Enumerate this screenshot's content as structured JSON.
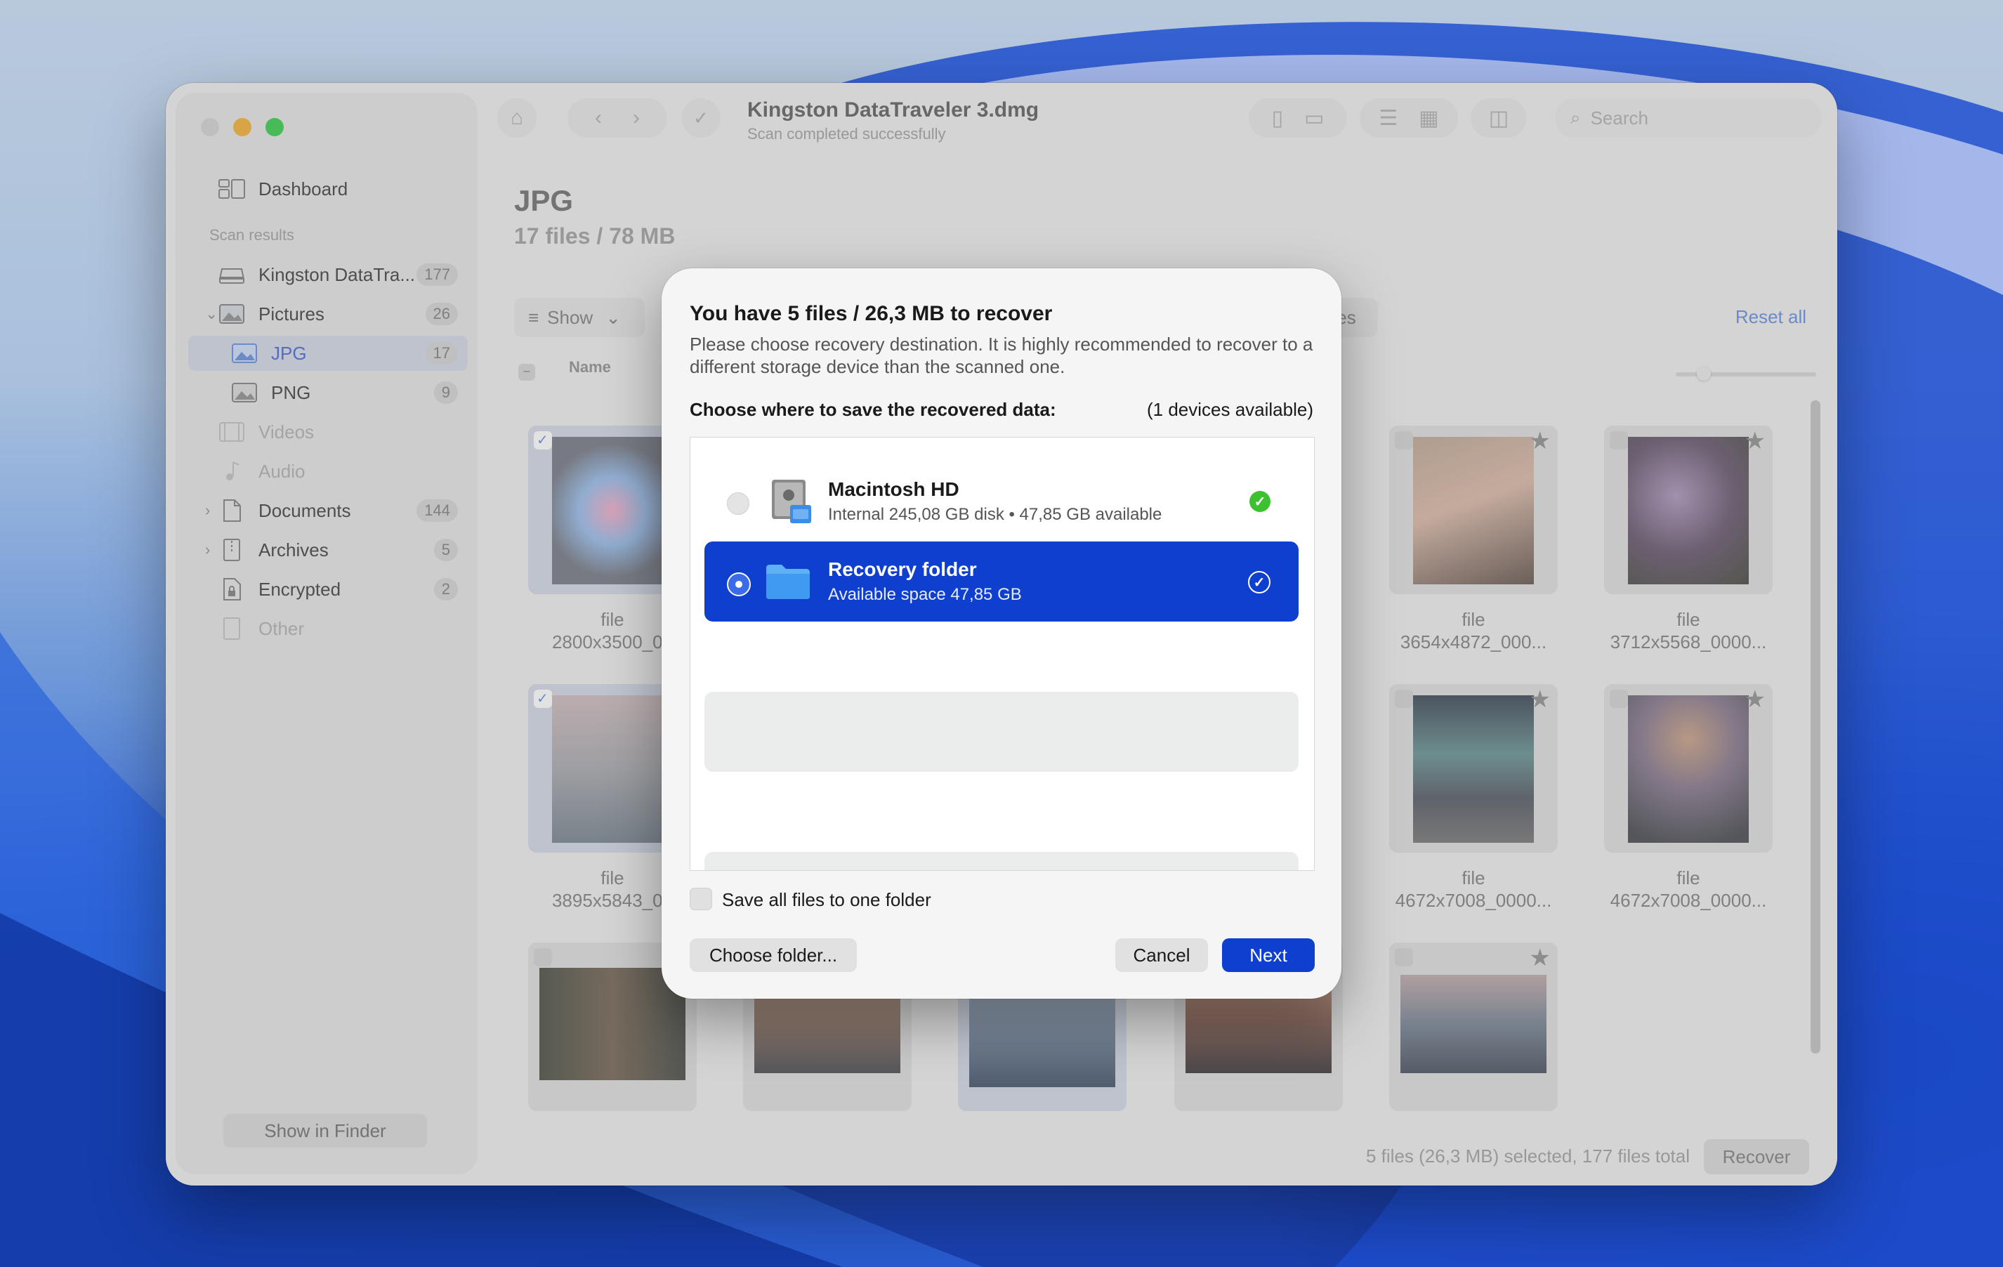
{
  "window": {
    "title": "Kingston DataTraveler 3.dmg",
    "subtitle": "Scan completed successfully",
    "search_placeholder": "Search"
  },
  "sidebar": {
    "dashboard_label": "Dashboard",
    "section_caption": "Scan results",
    "items": [
      {
        "label": "Kingston DataTra...",
        "count": "177",
        "icon": "drive-icon"
      },
      {
        "label": "Pictures",
        "count": "26",
        "icon": "pictures-icon"
      },
      {
        "label": "JPG",
        "count": "17",
        "icon": "image-icon"
      },
      {
        "label": "PNG",
        "count": "9",
        "icon": "image-icon"
      },
      {
        "label": "Videos",
        "count": "",
        "icon": "video-icon"
      },
      {
        "label": "Audio",
        "count": "",
        "icon": "music-icon"
      },
      {
        "label": "Documents",
        "count": "144",
        "icon": "document-icon"
      },
      {
        "label": "Archives",
        "count": "5",
        "icon": "archive-icon"
      },
      {
        "label": "Encrypted",
        "count": "2",
        "icon": "lock-document-icon"
      },
      {
        "label": "Other",
        "count": "",
        "icon": "file-icon"
      }
    ],
    "show_in_finder": "Show in Finder"
  },
  "main": {
    "heading": "JPG",
    "summary": "17 files / 78 MB",
    "show_button": "Show",
    "reset_all": "Reset all",
    "column_name": "Name",
    "partial_chip_text": "es",
    "files": [
      {
        "line1": "file",
        "line2": "2800x3500_00"
      },
      {
        "line1": "file",
        "line2": "3654x4872_000..."
      },
      {
        "line1": "file",
        "line2": "3712x5568_0000..."
      },
      {
        "line1": "file",
        "line2": "3895x5843_00"
      },
      {
        "line1": "file",
        "line2": "4672x7008_0000..."
      },
      {
        "line1": "file",
        "line2": "4672x7008_0000..."
      }
    ]
  },
  "status_bar": {
    "summary": "5 files (26,3 MB) selected, 177 files total",
    "recover_button": "Recover"
  },
  "dialog": {
    "title": "You have 5 files / 26,3 MB to recover",
    "description": "Please choose recovery destination. It is highly recommended to recover to a different storage device than the scanned one.",
    "choose_label": "Choose where to save the recovered data:",
    "devices_available": "(1 devices available)",
    "destinations": [
      {
        "name": "Macintosh HD",
        "meta": "Internal 245,08 GB disk • 47,85 GB available",
        "selected": false
      },
      {
        "name": "Recovery folder",
        "meta": "Available space 47,85 GB",
        "selected": true
      }
    ],
    "save_all_label": "Save all files to one folder",
    "choose_folder_button": "Choose folder...",
    "cancel_button": "Cancel",
    "next_button": "Next"
  },
  "colors": {
    "accent": "#0f3fce",
    "success": "#3ec130",
    "traffic_yellow": "#f2a92a",
    "traffic_green": "#27c93f"
  }
}
